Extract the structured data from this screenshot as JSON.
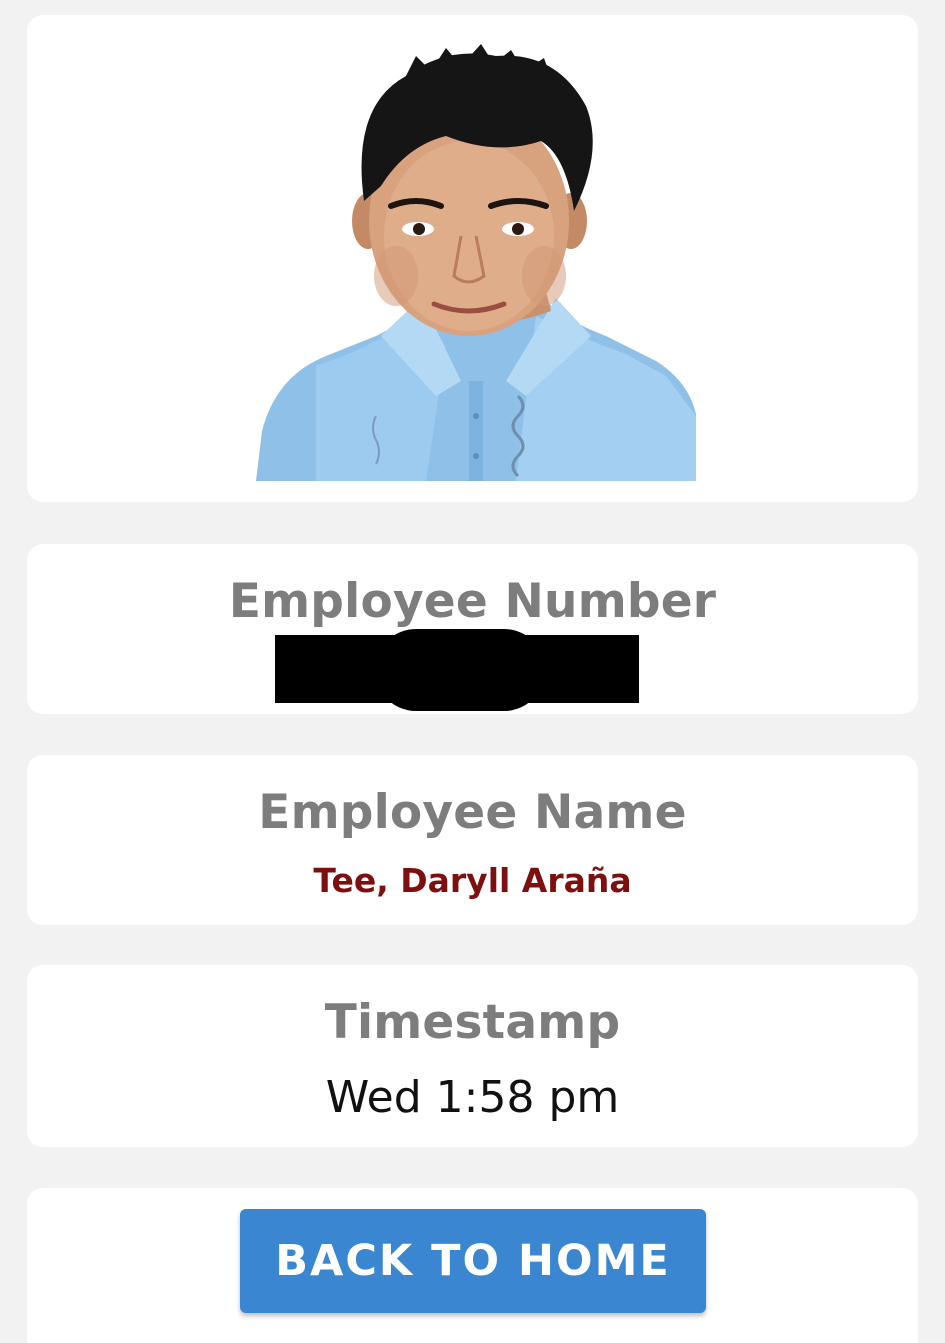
{
  "profile": {
    "photo_alt": "employee-photo"
  },
  "employee_number": {
    "label": "Employee Number",
    "value_redacted": true
  },
  "employee_name": {
    "label": "Employee Name",
    "value": "Tee, Daryll Araña"
  },
  "timestamp": {
    "label": "Timestamp",
    "value": "Wed 1:58 pm"
  },
  "actions": {
    "back_home_label": "BACK TO HOME"
  },
  "colors": {
    "page_background": "#f2f2f2",
    "card_background": "#ffffff",
    "label_gray": "#7d7d7d",
    "name_red": "#7e0f0f",
    "button_blue": "#3b86d1"
  }
}
